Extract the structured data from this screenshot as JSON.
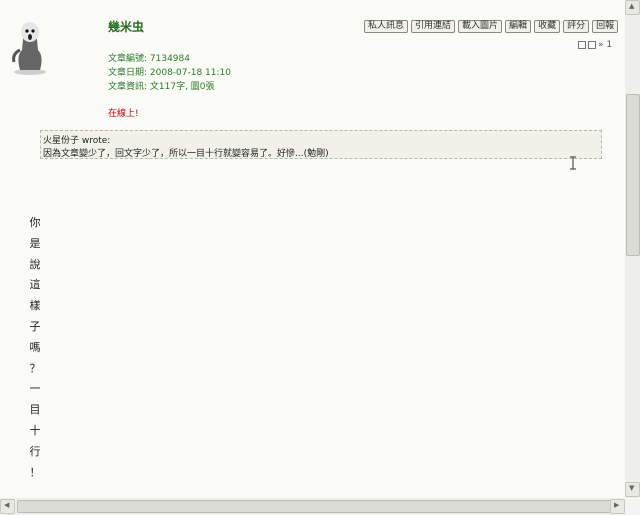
{
  "post": {
    "author": "幾米虫",
    "buttons": [
      "私人訊息",
      "引用連結",
      "載入圖片",
      "編輯",
      "收藏",
      "評分",
      "回報"
    ],
    "page_indicator": "» 1",
    "meta": [
      "文章編號: 7134984",
      "文章日期: 2008-07-18 11:10",
      "文章資訊: 文117字, 圖0張"
    ],
    "online_status": "在線上!",
    "quote": {
      "header": "火星份子 wrote:",
      "text": "因為文章變少了，回文字少了，所以一目十行就變容易了。好慘...(勉剛)"
    },
    "vertical_chars": [
      "你",
      "是",
      "說",
      "這",
      "樣",
      "子",
      "嗎",
      "？",
      "一",
      "目",
      "十",
      "行",
      "！"
    ]
  },
  "colors": {
    "author": "#1f6f1f",
    "meta": "#2a7a2a",
    "online": "#cc0000",
    "background": "#fafaf7"
  }
}
